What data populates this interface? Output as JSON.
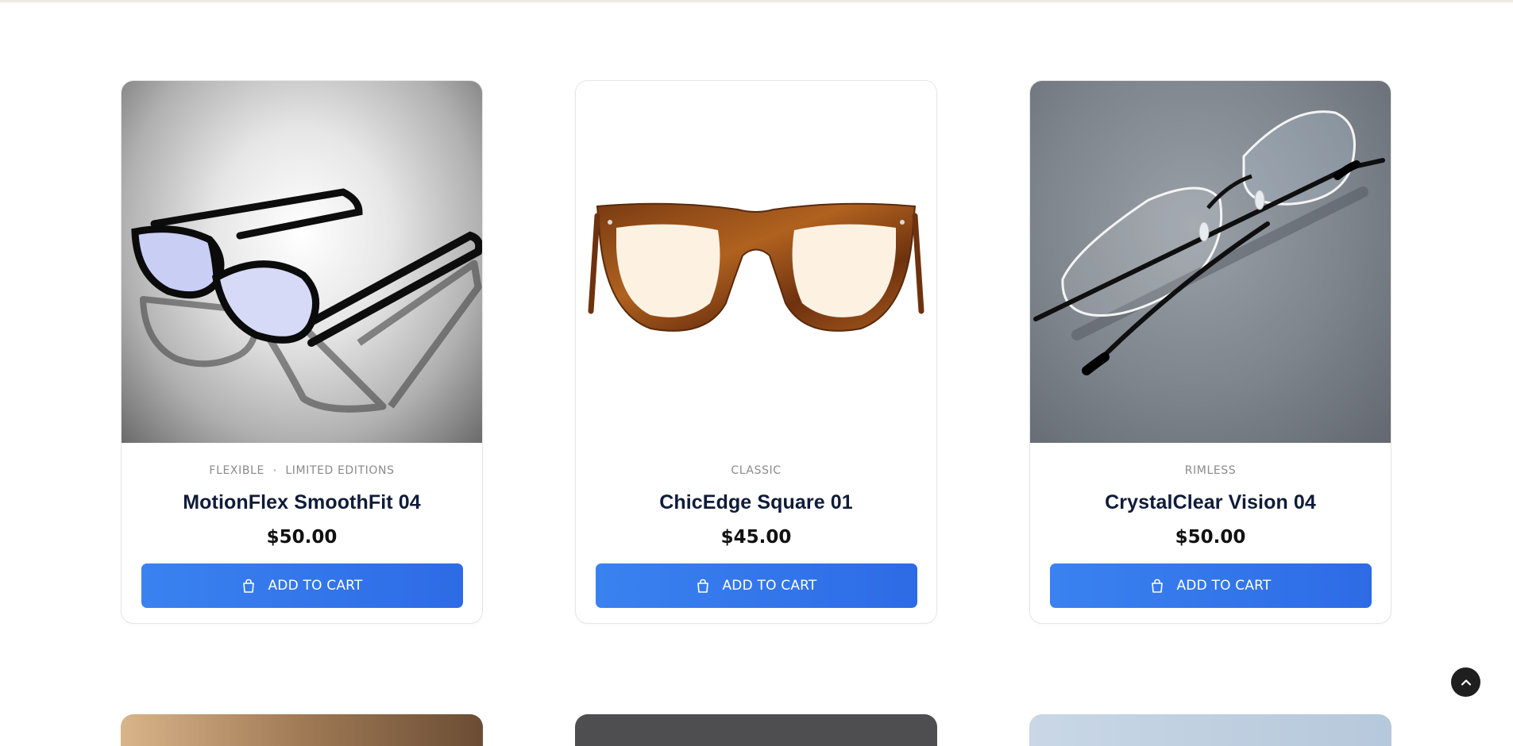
{
  "products": [
    {
      "tags": [
        "FLEXIBLE",
        "LIMITED EDITIONS"
      ],
      "name": "MotionFlex SmoothFit 04",
      "price": "$50.00",
      "button_label": "ADD TO CART"
    },
    {
      "tags": [
        "CLASSIC"
      ],
      "name": "ChicEdge Square 01",
      "price": "$45.00",
      "button_label": "ADD TO CART"
    },
    {
      "tags": [
        "RIMLESS"
      ],
      "name": "CrystalClear Vision 04",
      "price": "$50.00",
      "button_label": "ADD TO CART"
    }
  ],
  "icons": {
    "cart_button": "shopping-bag-icon",
    "back_to_top": "chevron-up-icon"
  },
  "colors": {
    "accent": "#2d6be6",
    "title": "#0f1b3a",
    "tag": "#8a8a8a"
  }
}
